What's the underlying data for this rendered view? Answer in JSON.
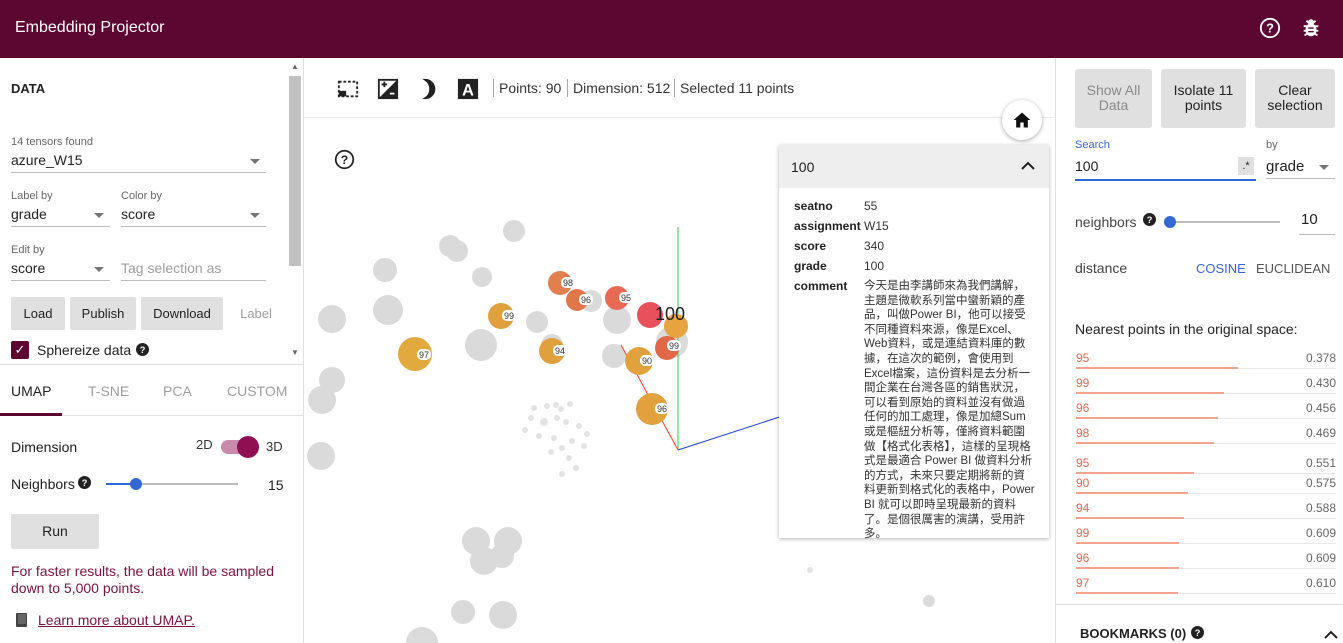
{
  "app": {
    "title": "Embedding Projector"
  },
  "left": {
    "section_title": "DATA",
    "tensors_found": "14 tensors found",
    "tensor": "azure_W15",
    "label_by": {
      "label": "Label by",
      "value": "grade"
    },
    "color_by": {
      "label": "Color by",
      "value": "score"
    },
    "edit_by": {
      "label": "Edit by",
      "value": "score"
    },
    "tag_placeholder": "Tag selection as",
    "buttons": {
      "load": "Load",
      "publish": "Publish",
      "download": "Download",
      "label": "Label"
    },
    "sphereize": {
      "label": "Sphereize data",
      "checked": true
    },
    "tabs": [
      "UMAP",
      "T-SNE",
      "PCA",
      "CUSTOM"
    ],
    "active_tab": "UMAP",
    "dimension": {
      "label": "Dimension",
      "opt2d": "2D",
      "opt3d": "3D",
      "selected": "3D"
    },
    "neighbors": {
      "label": "Neighbors",
      "value": "15"
    },
    "run": "Run",
    "note": "For faster results, the data will be sampled down to 5,000 points.",
    "learn_more": "Learn more about UMAP."
  },
  "toolbar": {
    "points": "Points: 90",
    "dimension": "Dimension: 512",
    "selected": "Selected 11 points"
  },
  "scene": {
    "selected_label": "100",
    "labels": [
      "98",
      "96",
      "95",
      "99",
      "99",
      "94",
      "90",
      "97",
      "96"
    ]
  },
  "inspector": {
    "header": "100",
    "rows": [
      {
        "key": "seatno",
        "value": "55"
      },
      {
        "key": "assignment",
        "value": "W15"
      },
      {
        "key": "score",
        "value": "340"
      },
      {
        "key": "grade",
        "value": "100"
      }
    ],
    "comment_key": "comment",
    "comment": "今天是由李講師來為我們講解，主題是微軟系列當中蠻新穎的產品，叫做Power BI，他可以接受不同種資料來源，像是Excel、Web資料，或是連結資料庫的數據，在這次的範例，會使用到Excel檔案，這份資料是去分析一間企業在台灣各區的銷售狀況，可以看到原始的資料並沒有做過任何的加工處理，像是加總Sum 或是樞紐分析等，僅將資料範圍做【格式化表格】，這樣的呈現格式是最適合 Power BI 做資料分析的方式，未來只要定期將新的資料更新到格式化的表格中，Power BI 就可以即時呈現最新的資料了。是個很厲害的演講，受用許多。"
  },
  "right": {
    "show_all": "Show All Data",
    "isolate": "Isolate 11 points",
    "clear": "Clear selection",
    "search_label": "Search",
    "search_value": "100",
    "regex": ".*",
    "by_label": "by",
    "by_value": "grade",
    "neighbors_label": "neighbors",
    "neighbors_value": "10",
    "distance_label": "distance",
    "cosine": "COSINE",
    "euclidean": "EUCLIDEAN",
    "nearest_title": "Nearest points in the original space:",
    "nearest": [
      {
        "label": "95",
        "value": "0.378"
      },
      {
        "label": "99",
        "value": "0.430"
      },
      {
        "label": "96",
        "value": "0.456"
      },
      {
        "label": "98",
        "value": "0.469"
      },
      {
        "label": "95",
        "value": "0.551"
      },
      {
        "label": "90",
        "value": "0.575"
      },
      {
        "label": "94",
        "value": "0.588"
      },
      {
        "label": "99",
        "value": "0.609"
      },
      {
        "label": "96",
        "value": "0.609"
      },
      {
        "label": "97",
        "value": "0.610"
      }
    ],
    "bookmarks": "BOOKMARKS (0)"
  },
  "colors": {
    "brand": "#5c0632",
    "accent": "#3367d6",
    "selected": "#e8505b",
    "orange": "#e0a03e"
  }
}
